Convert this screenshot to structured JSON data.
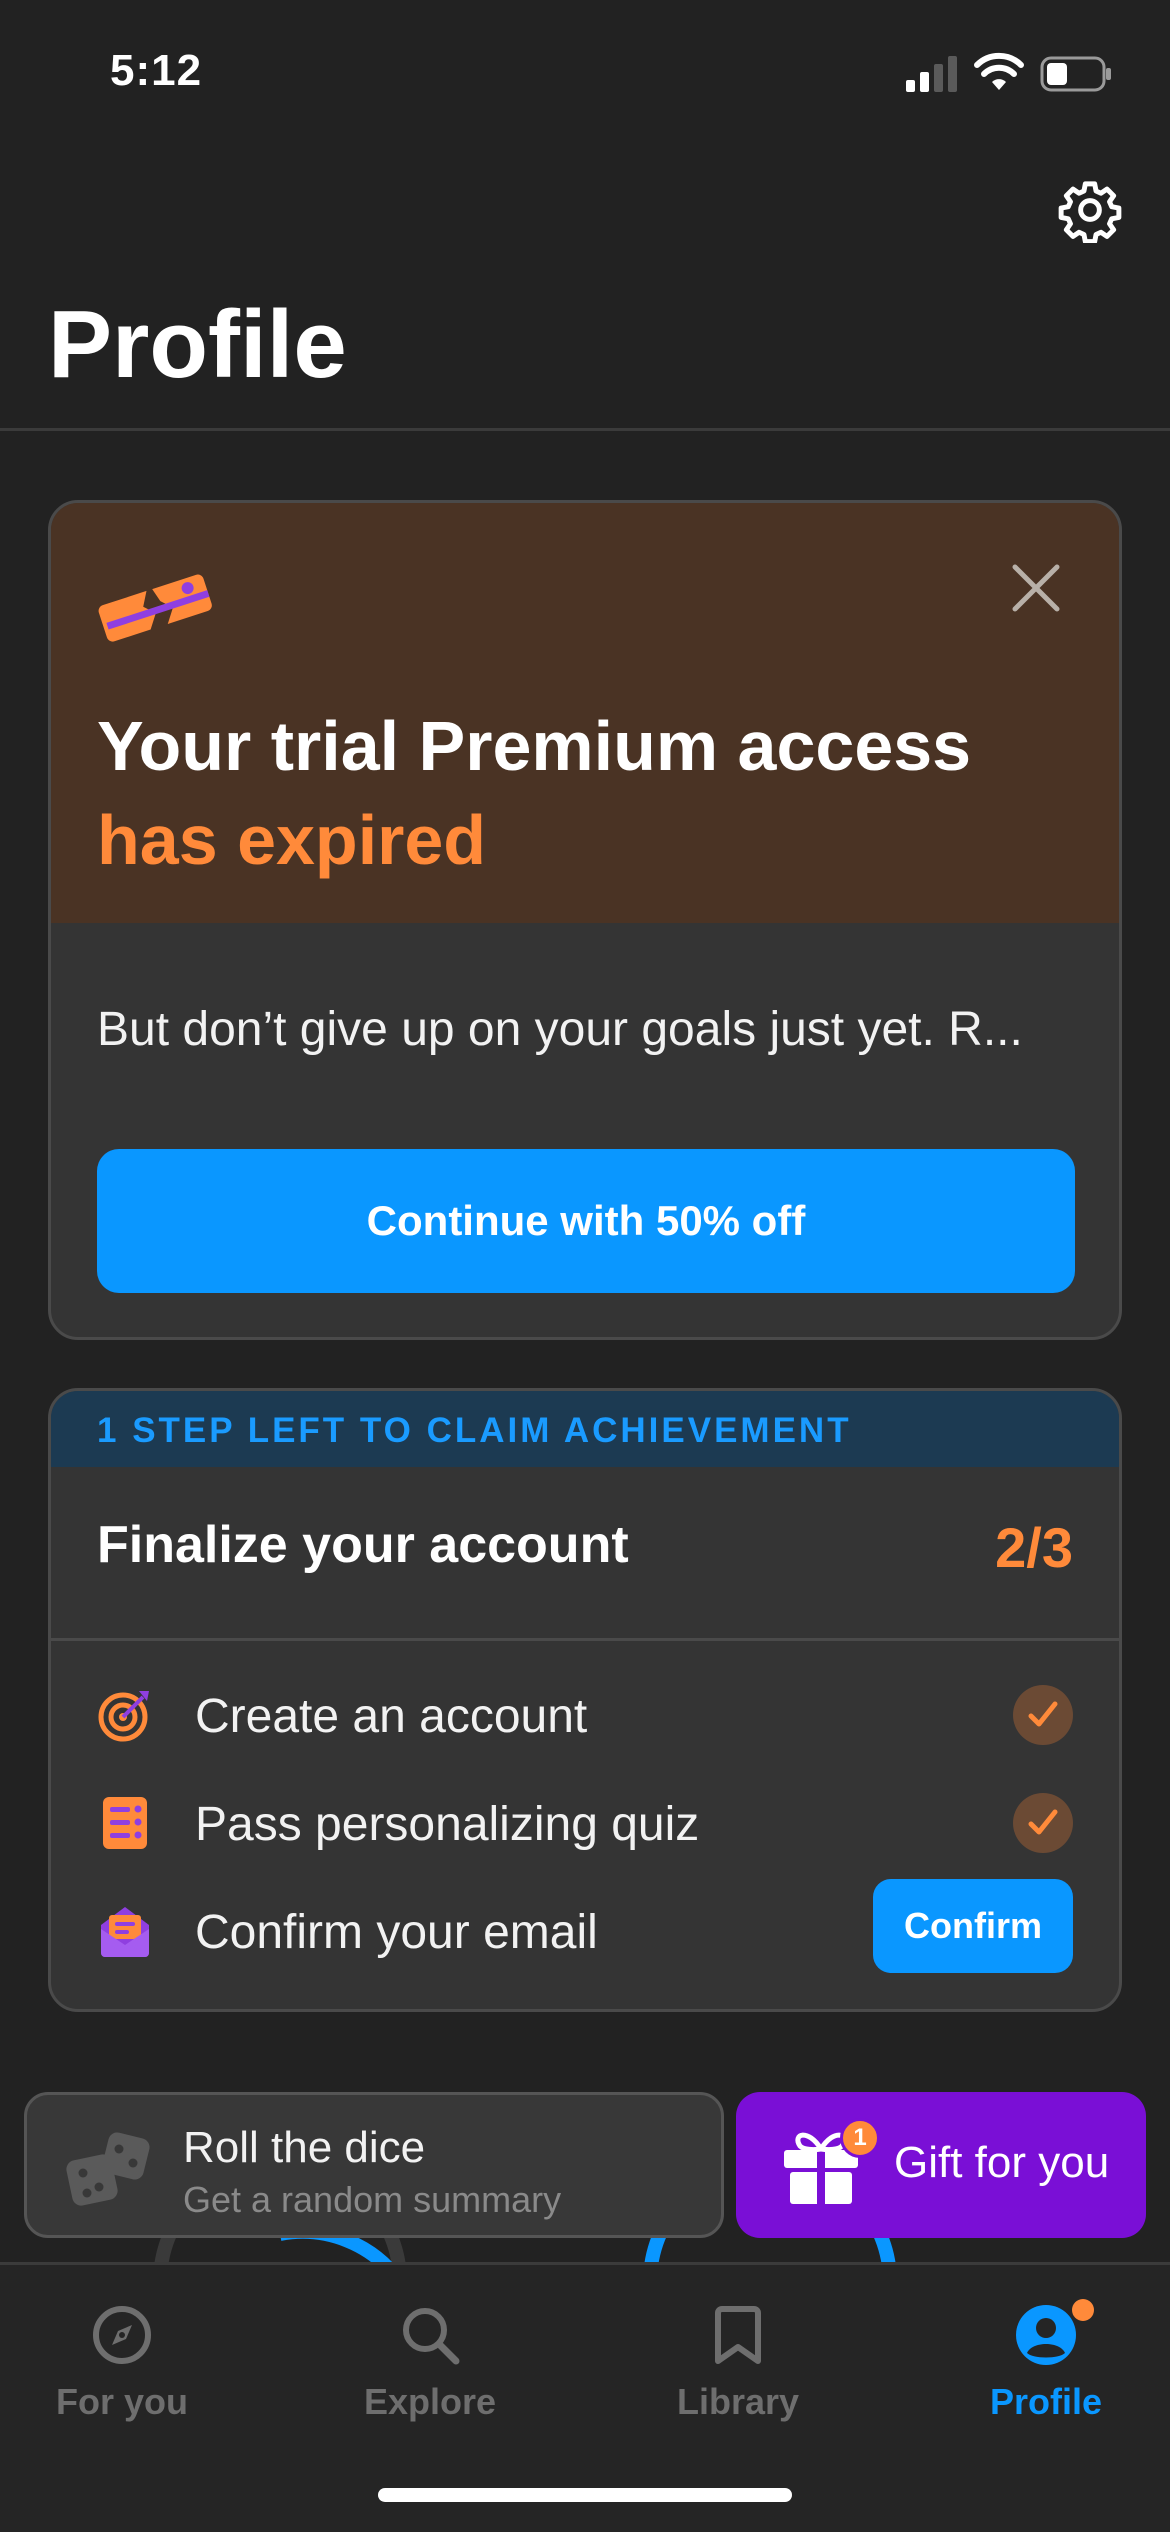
{
  "status_bar": {
    "time": "5:12"
  },
  "header": {
    "title": "Profile"
  },
  "trial_card": {
    "title_line1": "Your trial Premium access",
    "title_line2": "has expired",
    "body": "But don’t give up on your goals just yet. R...",
    "cta_label": "Continue with 50% off"
  },
  "achievement": {
    "banner": "1 STEP LEFT TO CLAIM ACHIEVEMENT",
    "title": "Finalize your account",
    "progress": "2/3",
    "tasks": [
      {
        "label": "Create an account",
        "icon": "target-icon",
        "done": true
      },
      {
        "label": "Pass personalizing quiz",
        "icon": "checklist-icon",
        "done": true
      },
      {
        "label": "Confirm your email",
        "icon": "envelope-icon",
        "done": false,
        "action_label": "Confirm"
      }
    ]
  },
  "quick_actions": {
    "dice_title": "Roll the dice",
    "dice_subtitle": "Get a random summary",
    "gift_label": "Gift for you",
    "gift_badge": "1"
  },
  "tab_bar": {
    "tabs": [
      {
        "label": "For you",
        "icon": "compass-icon",
        "active": false
      },
      {
        "label": "Explore",
        "icon": "search-icon",
        "active": false
      },
      {
        "label": "Library",
        "icon": "bookmark-icon",
        "active": false
      },
      {
        "label": "Profile",
        "icon": "profile-icon",
        "active": true
      }
    ]
  },
  "colors": {
    "background": "#222222",
    "accent_blue": "#0a97ff",
    "accent_orange": "#ff8a3a",
    "gift_purple": "#7a0fd6",
    "trial_header_brown": "#4a3324"
  }
}
